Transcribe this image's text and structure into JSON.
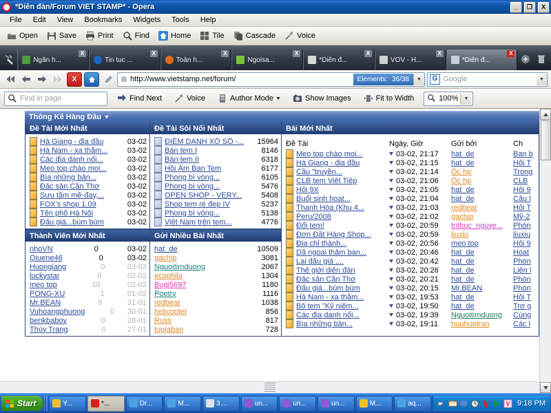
{
  "window": {
    "title": "*Diễn đàn/Forum VIET STAMP* - Opera",
    "icon": "opera-icon",
    "minimize": "_",
    "restore": "❐",
    "close": "X"
  },
  "menubar": {
    "items": [
      "File",
      "Edit",
      "View",
      "Bookmarks",
      "Widgets",
      "Tools",
      "Help"
    ]
  },
  "toolbar": {
    "buttons": [
      {
        "label": "Open",
        "icon": "folder-icon"
      },
      {
        "label": "Save",
        "icon": "floppy-disk-icon"
      },
      {
        "label": "Print",
        "icon": "printer-icon"
      },
      {
        "label": "Find",
        "icon": "magnifier-icon"
      },
      {
        "label": "Home",
        "icon": "home-icon"
      },
      {
        "label": "Tile",
        "icon": "tile-windows-icon"
      },
      {
        "label": "Cascade",
        "icon": "cascade-windows-icon"
      },
      {
        "label": "Voice",
        "icon": "microphone-icon"
      }
    ]
  },
  "tabs": {
    "wrench_icon": "wrench-icon",
    "new_tab_icon": "plus-circle-icon",
    "trash_icon": "trash-icon",
    "close_label": "X",
    "items": [
      {
        "label": "Ngân h...",
        "favicon_color": "#4f9a3c",
        "active": false
      },
      {
        "label": "Tin tuc ...",
        "favicon_color": "#1a66c0",
        "active": false
      },
      {
        "label": "Toàn h...",
        "favicon_color": "#e06a12",
        "active": false
      },
      {
        "label": "Ngoisa...",
        "favicon_color": "#79c33a",
        "active": false
      },
      {
        "label": "*Diễn đ...",
        "favicon_color": "#d8d8d8",
        "active": false
      },
      {
        "label": "VOV - H...",
        "favicon_color": "#cfcfcf",
        "active": false
      },
      {
        "label": "*Diễn đ...",
        "favicon_color": "#c8ccd4",
        "active": true
      }
    ]
  },
  "address": {
    "back_icon": "rewind-icon",
    "prev_icon": "arrow-left-icon",
    "next_icon": "arrow-right-icon",
    "forward_icon": "fast-forward-icon",
    "stop_label": "X",
    "stop_icon": "stop-icon",
    "home_icon": "home-icon",
    "edit_icon": "pencil-icon",
    "page_icon": "page-icon",
    "url": "http://www.vietstamp.net/forum/",
    "elements_label": "Elements:",
    "elements_value": "36/38",
    "dropdown_icon": "chevron-down-icon",
    "search_engine": "G",
    "search_placeholder": "Google",
    "search_dropdown_icon": "chevron-down-icon"
  },
  "findbar": {
    "find_icon": "magnifier-icon",
    "find_placeholder": "Find in page",
    "find_next_icon": "arrow-right-icon",
    "find_next": "Find Next",
    "voice_icon": "microphone-icon",
    "voice": "Voice",
    "author_mode_icon": "document-mode-icon",
    "author_mode": "Author Mode",
    "show_images_icon": "camera-icon",
    "show_images": "Show Images",
    "fit_width_icon": "fit-width-icon",
    "fit_width": "Fit to Width",
    "zoom_icon": "magnifier-icon",
    "zoom_level": "100%"
  },
  "page": {
    "stats_header": "Thông Kê Hàng Đầu",
    "panels": {
      "newest_topics": {
        "title": "Đề Tài Mới Nhất",
        "rows": [
          {
            "title": "Hà Giang - đia đầu",
            "date": "03-02"
          },
          {
            "title": "Hà Nam - xa thẳm...",
            "date": "03-02"
          },
          {
            "title": "Các đia danh nổi...",
            "date": "03-02"
          },
          {
            "title": "Meo top chào moi...",
            "date": "03-02"
          },
          {
            "title": "Bìa những bản...",
            "date": "03-02"
          },
          {
            "title": "Đăc sản Cần Thơ",
            "date": "03-02"
          },
          {
            "title": "Sưu tầm mề-đay,...",
            "date": "03-02"
          },
          {
            "title": "FOX's shop 1.09",
            "date": "03-02"
          },
          {
            "title": "Tên phố Hà Nôi",
            "date": "03-02"
          },
          {
            "title": "Đấu giá...bùm bùm",
            "date": "03-02"
          }
        ]
      },
      "hottest_topics": {
        "title": "Đề Tài Sôi Nổi Nhất",
        "rows": [
          {
            "title": "ĐIỂM DANH XỔ SỐ -...",
            "views": "15964"
          },
          {
            "title": "Bán tem I",
            "views": "8146"
          },
          {
            "title": "Bán tem II",
            "views": "6318"
          },
          {
            "title": "Hồi Âm Ban Tem",
            "views": "6177"
          },
          {
            "title": "Phong bì vòng...",
            "views": "6105"
          },
          {
            "title": "Phong bì vòng...",
            "views": "5476"
          },
          {
            "title": "OPEN SHOP - VERY...",
            "views": "5408"
          },
          {
            "title": "Shop tem rè đep IV",
            "views": "5237"
          },
          {
            "title": "Phong bì vòng...",
            "views": "5138"
          },
          {
            "title": "Viêt Nam trên tem...",
            "views": "4776"
          }
        ]
      },
      "newest_members": {
        "title": "Thành Viên Mới Nhất",
        "rows": [
          {
            "name": "nhoVN",
            "posts": "0",
            "date": "03-02",
            "dim": false
          },
          {
            "name": "Qiuene46",
            "posts": "0",
            "date": "03-02",
            "dim": false
          },
          {
            "name": "Huongiang",
            "posts": "0",
            "date": "03-02",
            "dim": true
          },
          {
            "name": "luckystar",
            "posts": "0",
            "date": "02-02",
            "dim": true
          },
          {
            "name": "meo top",
            "posts": "10",
            "date": "02-02",
            "dim": true
          },
          {
            "name": "PONG-XU",
            "posts": "1",
            "date": "01-02",
            "dim": true
          },
          {
            "name": "Mr.BEAN",
            "posts": "9",
            "date": "31-01",
            "dim": true
          },
          {
            "name": "Vuhoangphuong",
            "posts": "0",
            "date": "30-01",
            "dim": true
          },
          {
            "name": "benkbaboy",
            "posts": "0",
            "date": "28-01",
            "dim": true
          },
          {
            "name": "Thùy Trang",
            "posts": "0",
            "date": "27-01",
            "dim": true
          }
        ]
      },
      "top_posters": {
        "title": "Gửi Nhiều Bài Nhất",
        "rows": [
          {
            "name": "hat_de",
            "posts": "10509",
            "color": "blue"
          },
          {
            "name": "gachjp",
            "posts": "3081",
            "color": "orange"
          },
          {
            "name": "Nguoitimduong",
            "posts": "2067",
            "color": "teal"
          },
          {
            "name": "ecophila",
            "posts": "1304",
            "color": "orange"
          },
          {
            "name": "Bugi5697",
            "posts": "1180",
            "color": "pink"
          },
          {
            "name": "Poetry",
            "posts": "1116",
            "color": "teal"
          },
          {
            "name": "redbear",
            "posts": "1038",
            "color": "orange"
          },
          {
            "name": "helicopter",
            "posts": "856",
            "color": "orange"
          },
          {
            "name": "Russ",
            "posts": "817",
            "color": "orange"
          },
          {
            "name": "tugiaban",
            "posts": "728",
            "color": "orange"
          }
        ]
      },
      "latest_posts": {
        "title": "Bài Mới Nhất",
        "columns": [
          "Đề Tài",
          "Ngày, Giờ",
          "Gửi bởi",
          "Ch"
        ],
        "rows": [
          {
            "topic": "Meo top chào moi...",
            "datetime": "03-02, 21:17",
            "author": "hat_de",
            "author_color": "blue",
            "forum": "Ban b"
          },
          {
            "topic": "Hà Giang - đia đầu",
            "datetime": "03-02, 21:15",
            "author": "hat_de",
            "author_color": "blue",
            "forum": "Hôi T"
          },
          {
            "topic": "Cầu \"truyền...",
            "datetime": "03-02, 21:14",
            "author": "Ốc hp",
            "author_color": "orange",
            "forum": "Trong"
          },
          {
            "topic": "CLB tem Viêt Tiêp",
            "datetime": "03-02, 21:06",
            "author": "Ốc hp",
            "author_color": "orange",
            "forum": "CLB "
          },
          {
            "topic": "Hôi 9X",
            "datetime": "03-02, 21:05",
            "author": "hat_de",
            "author_color": "blue",
            "forum": "Hôi 9"
          },
          {
            "topic": "Buổi sinh hoat...",
            "datetime": "03-02, 21:04",
            "author": "hat_de",
            "author_color": "blue",
            "forum": "Câu l"
          },
          {
            "topic": "Thanh Hóa (Khu 4...",
            "datetime": "03-02, 21:03",
            "author": "redbear",
            "author_color": "orange",
            "forum": "Hôi T"
          },
          {
            "topic": "Peru/2008",
            "datetime": "03-02, 21:02",
            "author": "gachjp",
            "author_color": "orange",
            "forum": "Mỹ-2"
          },
          {
            "topic": "Đổi tem!",
            "datetime": "03-02, 20:59",
            "author": "trithuc_nguye...",
            "author_color": "pink",
            "forum": "Phòn"
          },
          {
            "topic": "Đơn Đăt Hàng Shop...",
            "datetime": "03-02, 20:59",
            "author": "liuxiu",
            "author_color": "orange",
            "forum": "liuxiu"
          },
          {
            "topic": "Đia chỉ thành...",
            "datetime": "03-02, 20:56",
            "author": "meo top",
            "author_color": "blue",
            "forum": "Hôi 9"
          },
          {
            "topic": "Dã ngoai thăm ban...",
            "datetime": "03-02, 20:46",
            "author": "hat_de",
            "author_color": "blue",
            "forum": "Hoat"
          },
          {
            "topic": "Lai đấu giá ....",
            "datetime": "03-02, 20:42",
            "author": "hat_de",
            "author_color": "blue",
            "forum": "Phòn"
          },
          {
            "topic": "Thế giới diễn đàn",
            "datetime": "03-02, 20:26",
            "author": "hat_de",
            "author_color": "blue",
            "forum": "Liên l"
          },
          {
            "topic": "Đăc sản Cần Thơ",
            "datetime": "03-02, 20:21",
            "author": "hat_de",
            "author_color": "blue",
            "forum": "Phòn"
          },
          {
            "topic": "Đấu giá...bùm bùm",
            "datetime": "03-02, 20:15",
            "author": "Mr.BEAN",
            "author_color": "blue",
            "forum": "Phòn"
          },
          {
            "topic": "Hà Nam - xa thẳm...",
            "datetime": "03-02, 19:53",
            "author": "hat_de",
            "author_color": "blue",
            "forum": "Hôi T"
          },
          {
            "topic": "Bô tem \"Kỷ niêm...",
            "datetime": "03-02, 19:50",
            "author": "hat_de",
            "author_color": "blue",
            "forum": "Trơ g"
          },
          {
            "topic": "Các đia danh nổi...",
            "datetime": "03-02, 19:39",
            "author": "Nguoitimduong",
            "author_color": "green",
            "forum": "Cùng"
          },
          {
            "topic": "Bìa những bản...",
            "datetime": "03-02, 19:11",
            "author": "huuhuetran",
            "author_color": "orange",
            "forum": "Các l"
          }
        ]
      }
    }
  },
  "taskbar": {
    "start": "Start",
    "start_icon": "windows-flag-icon",
    "items": [
      {
        "label": "Y...",
        "icon": "yahoo-messenger-icon",
        "active": false
      },
      {
        "label": "*...",
        "icon": "opera-icon",
        "active": true
      },
      {
        "label": "Dr...",
        "icon": "app-icon",
        "active": false
      },
      {
        "label": "M...",
        "icon": "app-icon",
        "active": false
      },
      {
        "label": "3....",
        "icon": "document-icon",
        "active": false
      },
      {
        "label": "un...",
        "icon": "winrar-icon",
        "active": false
      },
      {
        "label": "un...",
        "icon": "winrar-icon",
        "active": false
      },
      {
        "label": "un...",
        "icon": "winrar-icon",
        "active": false
      },
      {
        "label": "M...",
        "icon": "yahoo-messenger-icon",
        "active": false
      },
      {
        "label": "aq...",
        "icon": "app-icon",
        "active": false
      }
    ],
    "tray_icons": [
      "network-icon",
      "mail-icon",
      "display-icon",
      "clock-icon",
      "v-red-icon",
      "play-green-icon",
      "v-pink-icon"
    ],
    "clock": "9:18 PM"
  }
}
